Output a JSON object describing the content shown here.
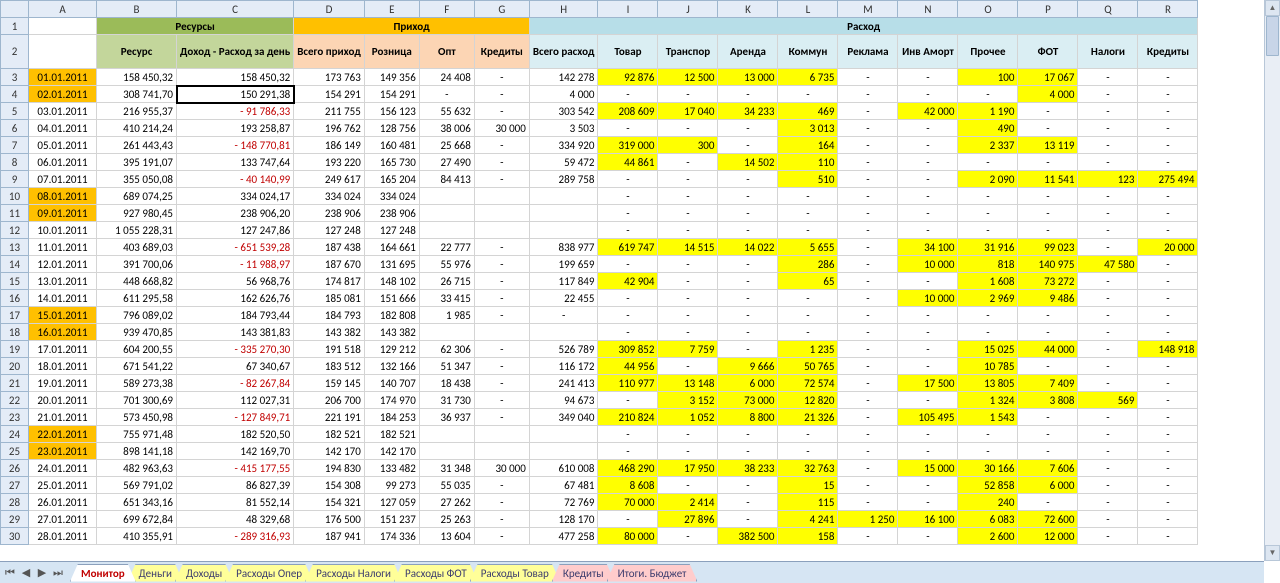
{
  "groups": {
    "res": "Ресурсы",
    "inc": "Приход",
    "exp": "Расход"
  },
  "hdr": {
    "B": "Ресурс",
    "C": "Доход - Расход за день",
    "D": "Всего приход",
    "E": "Розница",
    "F": "Опт",
    "G": "Кредиты",
    "H": "Всего расход",
    "I": "Товар",
    "J": "Транспор",
    "K": "Аренда",
    "L": "Коммун",
    "M": "Реклама",
    "N": "Инв Аморт",
    "O": "Прочее",
    "P": "ФОТ",
    "Q": "Налоги",
    "R": "Кредиты"
  },
  "cols": [
    "",
    "A",
    "B",
    "C",
    "D",
    "E",
    "F",
    "G",
    "H",
    "I",
    "J",
    "K",
    "L",
    "M",
    "N",
    "O",
    "P",
    "Q",
    "R"
  ],
  "rows": [
    {
      "n": 3,
      "dw": 1,
      "A": "01.01.2011",
      "B": "158 450,32",
      "C": "158 450,32",
      "D": "173 763",
      "E": "149 356",
      "F": "24 408",
      "G": "-",
      "H": "142 278",
      "I": "92 876",
      "J": "12 500",
      "K": "13 000",
      "L": "6 735",
      "M": "-",
      "N": "-",
      "O": "100",
      "P": "17 067",
      "Q": "-",
      "R": "-",
      "y": [
        "I",
        "J",
        "K",
        "L",
        "O",
        "P"
      ]
    },
    {
      "n": 4,
      "dw": 1,
      "A": "02.01.2011",
      "B": "308 741,70",
      "C": "150 291,38",
      "sel": 1,
      "D": "154 291",
      "E": "154 291",
      "F": "-",
      "G": "-",
      "H": "4 000",
      "I": "-",
      "J": "-",
      "K": "-",
      "L": "-",
      "M": "-",
      "N": "-",
      "O": "-",
      "P": "4 000",
      "Q": "-",
      "R": "-",
      "y": [
        "P"
      ]
    },
    {
      "n": 5,
      "A": "03.01.2011",
      "B": "216 955,37",
      "C": "91 786,33",
      "neg": 1,
      "D": "211 755",
      "E": "156 123",
      "F": "55 632",
      "G": "-",
      "H": "303 542",
      "I": "208 609",
      "J": "17 040",
      "K": "34 233",
      "L": "469",
      "M": "-",
      "N": "42 000",
      "O": "1 190",
      "P": "-",
      "Q": "-",
      "R": "-",
      "y": [
        "I",
        "J",
        "K",
        "L",
        "N",
        "O"
      ]
    },
    {
      "n": 6,
      "A": "04.01.2011",
      "B": "410 214,24",
      "C": "193 258,87",
      "D": "196 762",
      "E": "128 756",
      "F": "38 006",
      "G": "30 000",
      "H": "3 503",
      "I": "-",
      "J": "-",
      "K": "-",
      "L": "3 013",
      "M": "-",
      "N": "-",
      "O": "490",
      "P": "-",
      "Q": "-",
      "R": "-",
      "y": [
        "L",
        "O"
      ]
    },
    {
      "n": 7,
      "A": "05.01.2011",
      "B": "261 443,43",
      "C": "148 770,81",
      "neg": 1,
      "D": "186 149",
      "E": "160 481",
      "F": "25 668",
      "G": "-",
      "H": "334 920",
      "I": "319 000",
      "J": "300",
      "K": "-",
      "L": "164",
      "M": "-",
      "N": "-",
      "O": "2 337",
      "P": "13 119",
      "Q": "-",
      "R": "-",
      "y": [
        "I",
        "J",
        "L",
        "O",
        "P"
      ]
    },
    {
      "n": 8,
      "A": "06.01.2011",
      "B": "395 191,07",
      "C": "133 747,64",
      "D": "193 220",
      "E": "165 730",
      "F": "27 490",
      "G": "-",
      "H": "59 472",
      "I": "44 861",
      "J": "-",
      "K": "14 502",
      "L": "110",
      "M": "-",
      "N": "-",
      "O": "-",
      "P": "-",
      "Q": "-",
      "R": "-",
      "y": [
        "I",
        "K",
        "L"
      ]
    },
    {
      "n": 9,
      "A": "07.01.2011",
      "B": "355 050,08",
      "C": "40 140,99",
      "neg": 1,
      "D": "249 617",
      "E": "165 204",
      "F": "84 413",
      "G": "-",
      "H": "289 758",
      "I": "-",
      "J": "-",
      "K": "-",
      "L": "510",
      "M": "-",
      "N": "-",
      "O": "2 090",
      "P": "11 541",
      "Q": "123",
      "R": "275 494",
      "y": [
        "L",
        "O",
        "P",
        "Q",
        "R"
      ]
    },
    {
      "n": 10,
      "dw": 1,
      "A": "08.01.2011",
      "B": "689 074,25",
      "C": "334 024,17",
      "D": "334 024",
      "E": "334 024",
      "F": "",
      "G": "",
      "H": "",
      "I": "-",
      "J": "-",
      "K": "-",
      "L": "-",
      "M": "-",
      "N": "-",
      "O": "-",
      "P": "-",
      "Q": "-",
      "R": "-"
    },
    {
      "n": 11,
      "dw": 1,
      "A": "09.01.2011",
      "B": "927 980,45",
      "C": "238 906,20",
      "D": "238 906",
      "E": "238 906",
      "F": "",
      "G": "",
      "H": "",
      "I": "-",
      "J": "-",
      "K": "-",
      "L": "-",
      "M": "-",
      "N": "-",
      "O": "-",
      "P": "-",
      "Q": "-",
      "R": "-"
    },
    {
      "n": 12,
      "A": "10.01.2011",
      "B": "1 055 228,31",
      "C": "127 247,86",
      "D": "127 248",
      "E": "127 248",
      "F": "",
      "G": "",
      "H": "",
      "I": "-",
      "J": "-",
      "K": "-",
      "L": "-",
      "M": "-",
      "N": "-",
      "O": "-",
      "P": "-",
      "Q": "-",
      "R": "-"
    },
    {
      "n": 13,
      "A": "11.01.2011",
      "B": "403 689,03",
      "C": "651 539,28",
      "neg": 1,
      "D": "187 438",
      "E": "164 661",
      "F": "22 777",
      "G": "-",
      "H": "838 977",
      "I": "619 747",
      "J": "14 515",
      "K": "14 022",
      "L": "5 655",
      "M": "-",
      "N": "34 100",
      "O": "31 916",
      "P": "99 023",
      "Q": "-",
      "R": "20 000",
      "y": [
        "I",
        "J",
        "K",
        "L",
        "N",
        "O",
        "P",
        "R"
      ]
    },
    {
      "n": 14,
      "A": "12.01.2011",
      "B": "391 700,06",
      "C": "11 988,97",
      "neg": 1,
      "D": "187 670",
      "E": "131 695",
      "F": "55 976",
      "G": "-",
      "H": "199 659",
      "I": "-",
      "J": "-",
      "K": "-",
      "L": "286",
      "M": "-",
      "N": "10 000",
      "O": "818",
      "P": "140 975",
      "Q": "47 580",
      "R": "-",
      "y": [
        "L",
        "N",
        "O",
        "P",
        "Q"
      ]
    },
    {
      "n": 15,
      "A": "13.01.2011",
      "B": "448 668,82",
      "C": "56 968,76",
      "D": "174 817",
      "E": "148 102",
      "F": "26 715",
      "G": "-",
      "H": "117 849",
      "I": "42 904",
      "J": "-",
      "K": "-",
      "L": "65",
      "M": "-",
      "N": "-",
      "O": "1 608",
      "P": "73 272",
      "Q": "-",
      "R": "-",
      "y": [
        "I",
        "L",
        "O",
        "P"
      ]
    },
    {
      "n": 16,
      "A": "14.01.2011",
      "B": "611 295,58",
      "C": "162 626,76",
      "D": "185 081",
      "E": "151 666",
      "F": "33 415",
      "G": "-",
      "H": "22 455",
      "I": "-",
      "J": "-",
      "K": "-",
      "L": "-",
      "M": "-",
      "N": "10 000",
      "O": "2 969",
      "P": "9 486",
      "Q": "-",
      "R": "-",
      "y": [
        "N",
        "O",
        "P"
      ]
    },
    {
      "n": 17,
      "dw": 1,
      "A": "15.01.2011",
      "B": "796 089,02",
      "C": "184 793,44",
      "D": "184 793",
      "E": "182 808",
      "F": "1 985",
      "G": "-",
      "H": "-",
      "I": "-",
      "J": "-",
      "K": "-",
      "L": "-",
      "M": "-",
      "N": "-",
      "O": "-",
      "P": "-",
      "Q": "-",
      "R": "-"
    },
    {
      "n": 18,
      "dw": 1,
      "A": "16.01.2011",
      "B": "939 470,85",
      "C": "143 381,83",
      "D": "143 382",
      "E": "143 382",
      "F": "",
      "G": "",
      "H": "",
      "I": "-",
      "J": "-",
      "K": "-",
      "L": "-",
      "M": "-",
      "N": "-",
      "O": "-",
      "P": "-",
      "Q": "-",
      "R": "-"
    },
    {
      "n": 19,
      "A": "17.01.2011",
      "B": "604 200,55",
      "C": "335 270,30",
      "neg": 1,
      "D": "191 518",
      "E": "129 212",
      "F": "62 306",
      "G": "-",
      "H": "526 789",
      "I": "309 852",
      "J": "7 759",
      "K": "-",
      "L": "1 235",
      "M": "-",
      "N": "-",
      "O": "15 025",
      "P": "44 000",
      "Q": "-",
      "R": "148 918",
      "y": [
        "I",
        "J",
        "L",
        "O",
        "P",
        "R"
      ]
    },
    {
      "n": 20,
      "A": "18.01.2011",
      "B": "671 541,22",
      "C": "67 340,67",
      "D": "183 512",
      "E": "132 166",
      "F": "51 347",
      "G": "-",
      "H": "116 172",
      "I": "44 956",
      "J": "-",
      "K": "9 666",
      "L": "50 765",
      "M": "-",
      "N": "-",
      "O": "10 785",
      "P": "-",
      "Q": "-",
      "R": "-",
      "y": [
        "I",
        "K",
        "L",
        "O"
      ]
    },
    {
      "n": 21,
      "A": "19.01.2011",
      "B": "589 273,38",
      "C": "82 267,84",
      "neg": 1,
      "D": "159 145",
      "E": "140 707",
      "F": "18 438",
      "G": "-",
      "H": "241 413",
      "I": "110 977",
      "J": "13 148",
      "K": "6 000",
      "L": "72 574",
      "M": "-",
      "N": "17 500",
      "O": "13 805",
      "P": "7 409",
      "Q": "-",
      "R": "-",
      "y": [
        "I",
        "J",
        "K",
        "L",
        "N",
        "O",
        "P"
      ]
    },
    {
      "n": 22,
      "A": "20.01.2011",
      "B": "701 300,69",
      "C": "112 027,31",
      "D": "206 700",
      "E": "174 970",
      "F": "31 730",
      "G": "-",
      "H": "94 673",
      "I": "-",
      "J": "3 152",
      "K": "73 000",
      "L": "12 820",
      "M": "-",
      "N": "-",
      "O": "1 324",
      "P": "3 808",
      "Q": "569",
      "R": "-",
      "y": [
        "J",
        "K",
        "L",
        "O",
        "P",
        "Q"
      ]
    },
    {
      "n": 23,
      "A": "21.01.2011",
      "B": "573 450,98",
      "C": "127 849,71",
      "neg": 1,
      "D": "221 191",
      "E": "184 253",
      "F": "36 937",
      "G": "-",
      "H": "349 040",
      "I": "210 824",
      "J": "1 052",
      "K": "8 800",
      "L": "21 326",
      "M": "-",
      "N": "105 495",
      "O": "1 543",
      "P": "-",
      "Q": "-",
      "R": "-",
      "y": [
        "I",
        "J",
        "K",
        "L",
        "N",
        "O"
      ]
    },
    {
      "n": 24,
      "dw": 1,
      "A": "22.01.2011",
      "B": "755 971,48",
      "C": "182 520,50",
      "D": "182 521",
      "E": "182 521",
      "F": "",
      "G": "",
      "H": "",
      "I": "-",
      "J": "-",
      "K": "-",
      "L": "-",
      "M": "-",
      "N": "-",
      "O": "-",
      "P": "-",
      "Q": "-",
      "R": "-"
    },
    {
      "n": 25,
      "dw": 1,
      "A": "23.01.2011",
      "B": "898 141,18",
      "C": "142 169,70",
      "D": "142 170",
      "E": "142 170",
      "F": "",
      "G": "",
      "H": "",
      "I": "-",
      "J": "-",
      "K": "-",
      "L": "-",
      "M": "-",
      "N": "-",
      "O": "-",
      "P": "-",
      "Q": "-",
      "R": "-"
    },
    {
      "n": 26,
      "A": "24.01.2011",
      "B": "482 963,63",
      "C": "415 177,55",
      "neg": 1,
      "D": "194 830",
      "E": "133 482",
      "F": "31 348",
      "G": "30 000",
      "H": "610 008",
      "I": "468 290",
      "J": "17 950",
      "K": "38 233",
      "L": "32 763",
      "M": "-",
      "N": "15 000",
      "O": "30 166",
      "P": "7 606",
      "Q": "-",
      "R": "-",
      "y": [
        "I",
        "J",
        "K",
        "L",
        "N",
        "O",
        "P"
      ]
    },
    {
      "n": 27,
      "A": "25.01.2011",
      "B": "569 791,02",
      "C": "86 827,39",
      "D": "154 308",
      "E": "99 273",
      "F": "55 035",
      "G": "-",
      "H": "67 481",
      "I": "8 608",
      "J": "-",
      "K": "-",
      "L": "15",
      "M": "-",
      "N": "-",
      "O": "52 858",
      "P": "6 000",
      "Q": "-",
      "R": "-",
      "y": [
        "I",
        "L",
        "O",
        "P"
      ]
    },
    {
      "n": 28,
      "A": "26.01.2011",
      "B": "651 343,16",
      "C": "81 552,14",
      "D": "154 321",
      "E": "127 059",
      "F": "27 262",
      "G": "-",
      "H": "72 769",
      "I": "70 000",
      "J": "2 414",
      "K": "-",
      "L": "115",
      "M": "-",
      "N": "-",
      "O": "240",
      "P": "-",
      "Q": "-",
      "R": "-",
      "y": [
        "I",
        "J",
        "L",
        "O"
      ]
    },
    {
      "n": 29,
      "A": "27.01.2011",
      "B": "699 672,84",
      "C": "48 329,68",
      "D": "176 500",
      "E": "151 237",
      "F": "25 263",
      "G": "-",
      "H": "128 170",
      "I": "-",
      "J": "27 896",
      "K": "-",
      "L": "4 241",
      "M": "1 250",
      "N": "16 100",
      "O": "6 083",
      "P": "72 600",
      "Q": "-",
      "R": "-",
      "y": [
        "J",
        "L",
        "M",
        "N",
        "O",
        "P"
      ]
    },
    {
      "n": 30,
      "A": "28.01.2011",
      "B": "410 355,91",
      "C": "289 316,93",
      "neg": 1,
      "D": "187 941",
      "E": "174 336",
      "F": "13 604",
      "G": "-",
      "H": "477 258",
      "I": "80 000",
      "J": "-",
      "K": "382 500",
      "L": "158",
      "M": "-",
      "N": "-",
      "O": "2 600",
      "P": "12 000",
      "Q": "-",
      "R": "-",
      "y": [
        "I",
        "K",
        "L",
        "O",
        "P"
      ]
    }
  ],
  "tabs": [
    "Монитор",
    "Деньги",
    "Доходы",
    "Расходы Опер",
    "Расходы Налоги",
    "Расходы ФОТ",
    "Расходы Товар",
    "Кредиты",
    "Итоги. Бюджет"
  ],
  "tabColors": [
    "",
    "#ff9",
    "#ff9",
    "#ff9",
    "#ff9",
    "#ff9",
    "#ff9",
    "#fcc",
    "#fcc"
  ],
  "activeTab": 0,
  "nav": {
    "first": "⏮",
    "prev": "◀",
    "next": "▶",
    "last": "⏭"
  }
}
